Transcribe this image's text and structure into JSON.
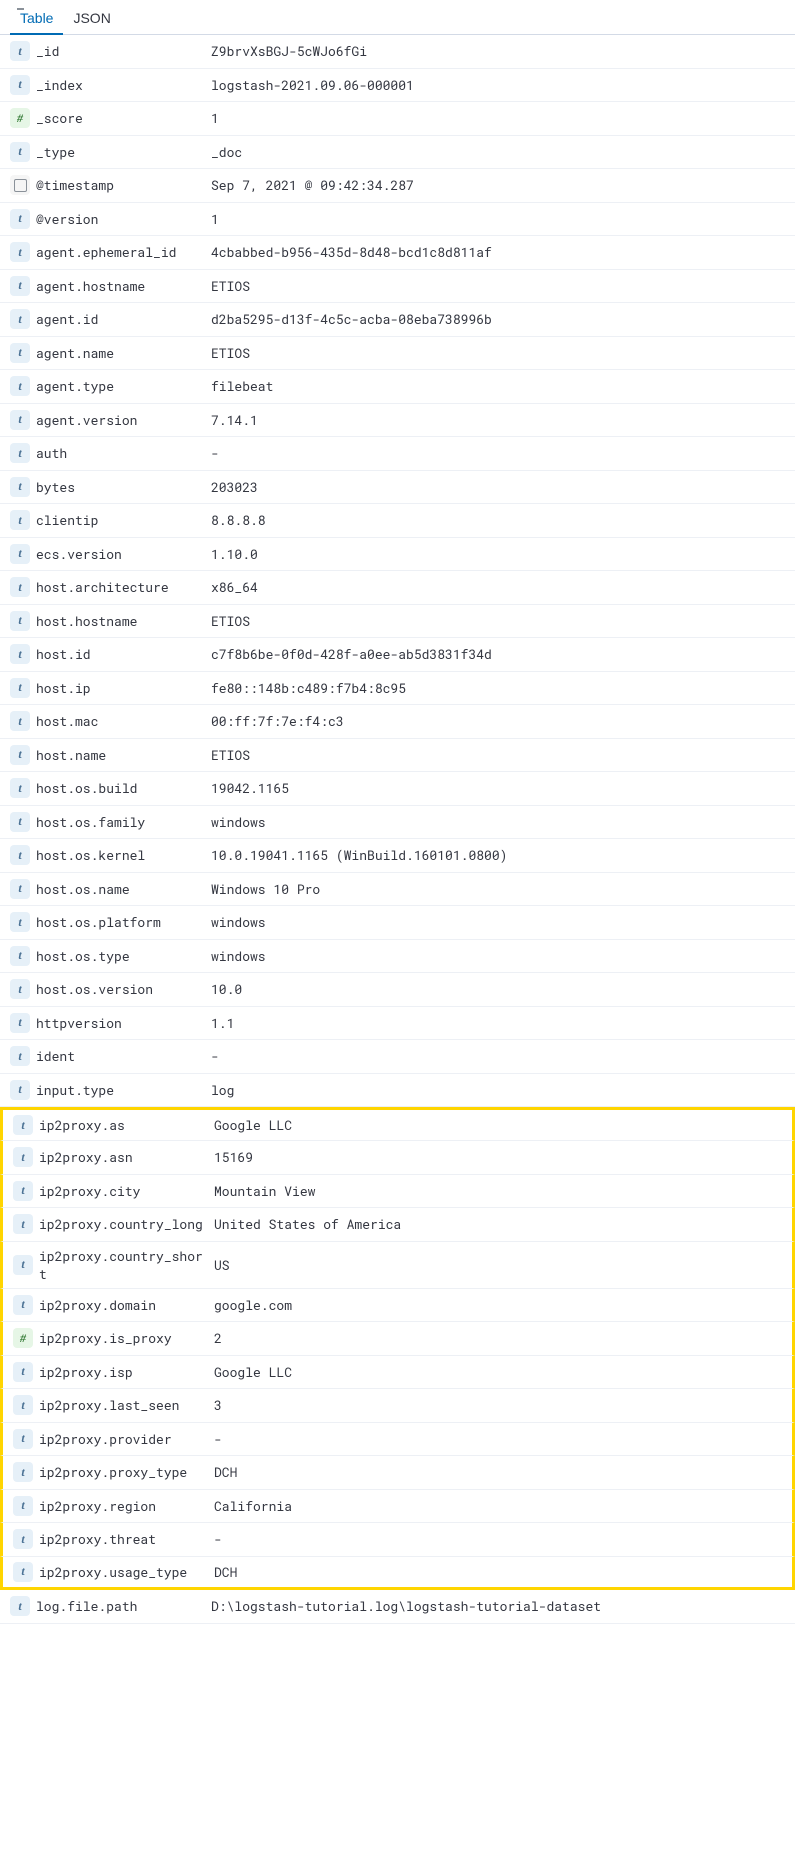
{
  "tabs": {
    "table": "Table",
    "json": "JSON"
  },
  "fields": [
    {
      "type": "t",
      "name": "_id",
      "value": "Z9brvXsBGJ-5cWJo6fGi",
      "hl": false
    },
    {
      "type": "t",
      "name": "_index",
      "value": "logstash-2021.09.06-000001",
      "hl": false
    },
    {
      "type": "n",
      "name": "_score",
      "value": "1",
      "hl": false
    },
    {
      "type": "t",
      "name": "_type",
      "value": "_doc",
      "hl": false
    },
    {
      "type": "d",
      "name": "@timestamp",
      "value": "Sep 7, 2021 @ 09:42:34.287",
      "hl": false
    },
    {
      "type": "t",
      "name": "@version",
      "value": "1",
      "hl": false
    },
    {
      "type": "t",
      "name": "agent.ephemeral_id",
      "value": "4cbabbed-b956-435d-8d48-bcd1c8d811af",
      "hl": false
    },
    {
      "type": "t",
      "name": "agent.hostname",
      "value": "ETIOS",
      "hl": false
    },
    {
      "type": "t",
      "name": "agent.id",
      "value": "d2ba5295-d13f-4c5c-acba-08eba738996b",
      "hl": false
    },
    {
      "type": "t",
      "name": "agent.name",
      "value": "ETIOS",
      "hl": false
    },
    {
      "type": "t",
      "name": "agent.type",
      "value": "filebeat",
      "hl": false
    },
    {
      "type": "t",
      "name": "agent.version",
      "value": "7.14.1",
      "hl": false
    },
    {
      "type": "t",
      "name": "auth",
      "value": "-",
      "hl": false
    },
    {
      "type": "t",
      "name": "bytes",
      "value": "203023",
      "hl": false
    },
    {
      "type": "t",
      "name": "clientip",
      "value": "8.8.8.8",
      "hl": false
    },
    {
      "type": "t",
      "name": "ecs.version",
      "value": "1.10.0",
      "hl": false
    },
    {
      "type": "t",
      "name": "host.architecture",
      "value": "x86_64",
      "hl": false
    },
    {
      "type": "t",
      "name": "host.hostname",
      "value": "ETIOS",
      "hl": false
    },
    {
      "type": "t",
      "name": "host.id",
      "value": "c7f8b6be-0f0d-428f-a0ee-ab5d3831f34d",
      "hl": false
    },
    {
      "type": "t",
      "name": "host.ip",
      "value": "fe80::148b:c489:f7b4:8c95",
      "hl": false
    },
    {
      "type": "t",
      "name": "host.mac",
      "value": "00:ff:7f:7e:f4:c3",
      "hl": false
    },
    {
      "type": "t",
      "name": "host.name",
      "value": "ETIOS",
      "hl": false
    },
    {
      "type": "t",
      "name": "host.os.build",
      "value": "19042.1165",
      "hl": false
    },
    {
      "type": "t",
      "name": "host.os.family",
      "value": "windows",
      "hl": false
    },
    {
      "type": "t",
      "name": "host.os.kernel",
      "value": "10.0.19041.1165 (WinBuild.160101.0800)",
      "hl": false
    },
    {
      "type": "t",
      "name": "host.os.name",
      "value": "Windows 10 Pro",
      "hl": false
    },
    {
      "type": "t",
      "name": "host.os.platform",
      "value": "windows",
      "hl": false
    },
    {
      "type": "t",
      "name": "host.os.type",
      "value": "windows",
      "hl": false
    },
    {
      "type": "t",
      "name": "host.os.version",
      "value": "10.0",
      "hl": false
    },
    {
      "type": "t",
      "name": "httpversion",
      "value": "1.1",
      "hl": false
    },
    {
      "type": "t",
      "name": "ident",
      "value": "-",
      "hl": false
    },
    {
      "type": "t",
      "name": "input.type",
      "value": "log",
      "hl": false
    },
    {
      "type": "t",
      "name": "ip2proxy.as",
      "value": "Google LLC",
      "hl": true,
      "hltop": true
    },
    {
      "type": "t",
      "name": "ip2proxy.asn",
      "value": "15169",
      "hl": true
    },
    {
      "type": "t",
      "name": "ip2proxy.city",
      "value": "Mountain View",
      "hl": true
    },
    {
      "type": "t",
      "name": "ip2proxy.country_long",
      "value": "United States of America",
      "hl": true
    },
    {
      "type": "t",
      "name": "ip2proxy.country_short",
      "value": "US",
      "hl": true
    },
    {
      "type": "t",
      "name": "ip2proxy.domain",
      "value": "google.com",
      "hl": true
    },
    {
      "type": "n",
      "name": "ip2proxy.is_proxy",
      "value": "2",
      "hl": true
    },
    {
      "type": "t",
      "name": "ip2proxy.isp",
      "value": "Google LLC",
      "hl": true
    },
    {
      "type": "t",
      "name": "ip2proxy.last_seen",
      "value": "3",
      "hl": true
    },
    {
      "type": "t",
      "name": "ip2proxy.provider",
      "value": "-",
      "hl": true
    },
    {
      "type": "t",
      "name": "ip2proxy.proxy_type",
      "value": "DCH",
      "hl": true
    },
    {
      "type": "t",
      "name": "ip2proxy.region",
      "value": "California",
      "hl": true
    },
    {
      "type": "t",
      "name": "ip2proxy.threat",
      "value": "-",
      "hl": true
    },
    {
      "type": "t",
      "name": "ip2proxy.usage_type",
      "value": "DCH",
      "hl": true,
      "hlbot": true
    },
    {
      "type": "t",
      "name": "log.file.path",
      "value": "D:\\logstash-tutorial.log\\logstash-tutorial-dataset",
      "hl": false
    }
  ]
}
